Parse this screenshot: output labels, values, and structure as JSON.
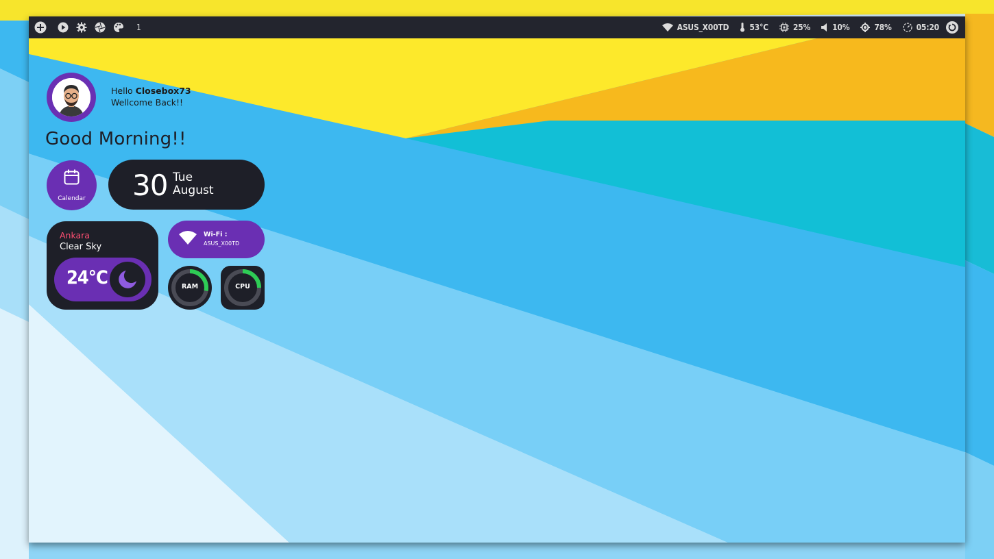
{
  "topbar": {
    "workspace": "1",
    "wifi_ssid": "ASUS_X00TD",
    "temperature": "53°C",
    "cpu": "25%",
    "volume": "10%",
    "brightness": "78%",
    "time": "05:20",
    "icons_left": [
      "add-icon",
      "play-icon",
      "gear-icon",
      "aperture-icon",
      "palette-icon"
    ],
    "icons_right": [
      "wifi-icon",
      "thermometer-icon",
      "chip-icon",
      "speaker-icon",
      "brightness-icon",
      "clock-icon",
      "power-icon"
    ]
  },
  "profile": {
    "hello": "Hello",
    "username": "Closebox73",
    "welcome": "Wellcome Back!!"
  },
  "greeting": "Good Morning!!",
  "calendar": {
    "label": "Calendar",
    "day_num": "30",
    "weekday": "Tue",
    "month": "August"
  },
  "weather": {
    "city": "Ankara",
    "condition": "Clear Sky",
    "temp": "24°C",
    "icon": "moon-icon"
  },
  "wifi_widget": {
    "title": "Wi-Fi :",
    "ssid": "ASUS_X00TD"
  },
  "gauges": {
    "ram_label": "RAM",
    "cpu_label": "CPU",
    "ram_fraction": 0.28,
    "cpu_fraction": 0.25
  },
  "colors": {
    "accent_purple": "#6a2fb3",
    "panel_dark": "#1e1f28",
    "gauge_green": "#2ecc55",
    "city_red": "#ff4f72"
  }
}
